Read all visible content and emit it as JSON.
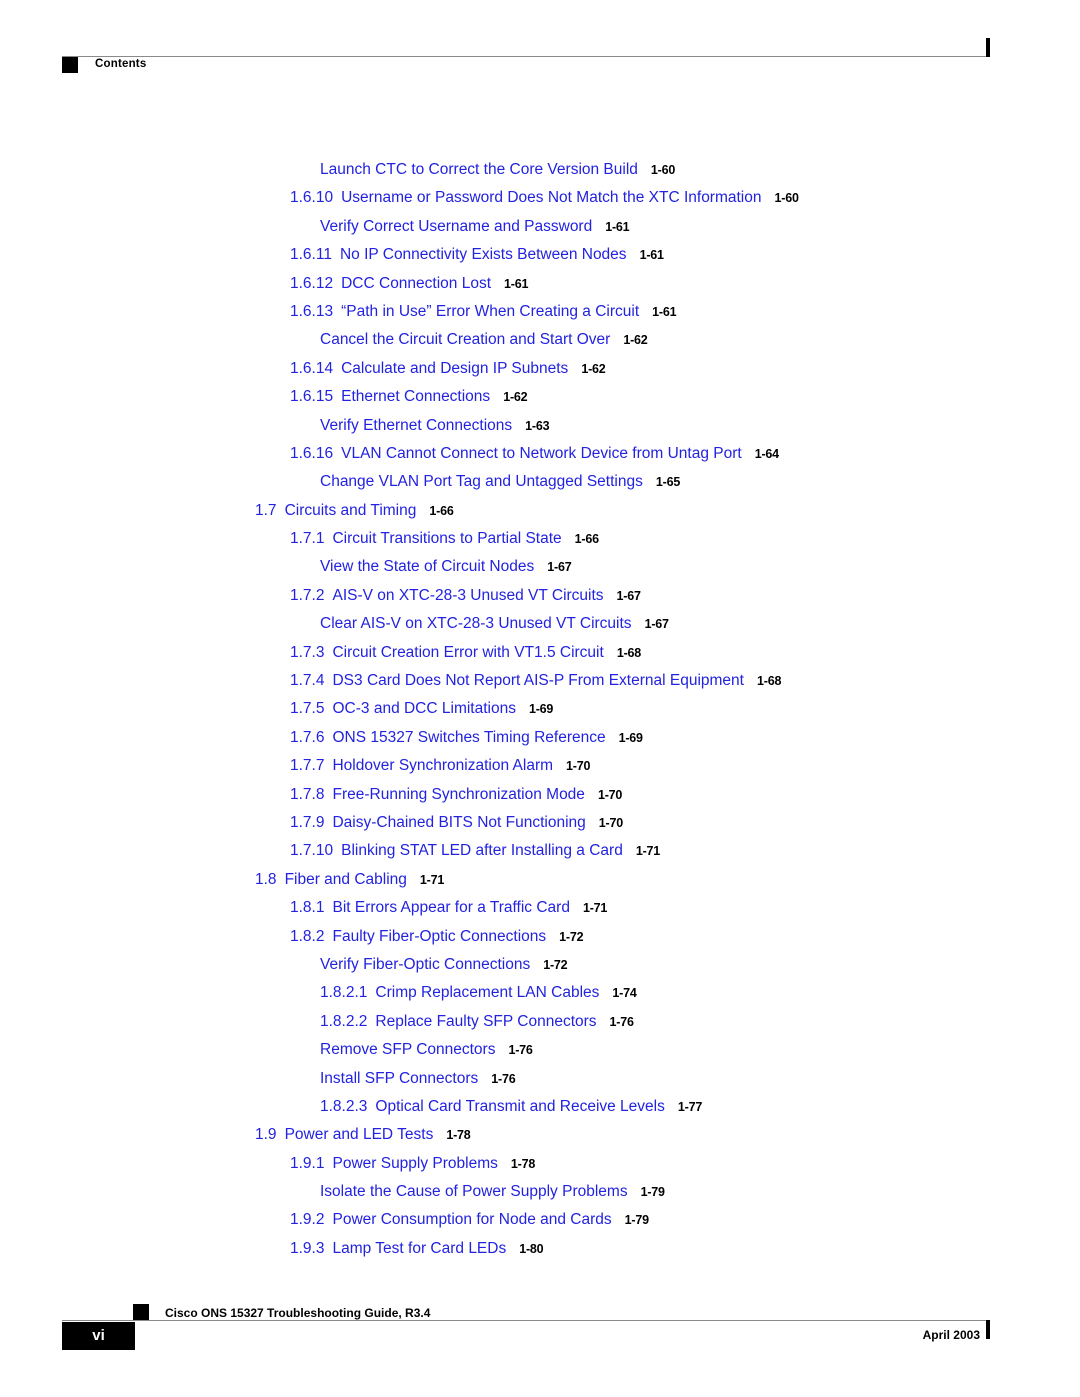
{
  "header": {
    "label": "Contents",
    "marker_icon": "black-square-marker",
    "rule_color": "#8a8a8a"
  },
  "theme": {
    "link_color": "#2222e0",
    "page_number_color": "#000000",
    "background": "#ffffff"
  },
  "toc": {
    "entries": [
      {
        "level": 3,
        "number": "",
        "title": "Launch CTC to Correct the Core Version Build",
        "page": "1-60"
      },
      {
        "level": 2,
        "number": "1.6.10",
        "title": "Username or Password Does Not Match the XTC Information",
        "page": "1-60"
      },
      {
        "level": 3,
        "number": "",
        "title": "Verify Correct Username and Password",
        "page": "1-61"
      },
      {
        "level": 2,
        "number": "1.6.11",
        "title": "No IP Connectivity Exists Between Nodes",
        "page": "1-61"
      },
      {
        "level": 2,
        "number": "1.6.12",
        "title": "DCC Connection Lost",
        "page": "1-61"
      },
      {
        "level": 2,
        "number": "1.6.13",
        "title": "“Path in Use” Error When Creating a Circuit",
        "page": "1-61"
      },
      {
        "level": 3,
        "number": "",
        "title": "Cancel the Circuit Creation and Start Over",
        "page": "1-62"
      },
      {
        "level": 2,
        "number": "1.6.14",
        "title": "Calculate and Design IP Subnets",
        "page": "1-62"
      },
      {
        "level": 2,
        "number": "1.6.15",
        "title": "Ethernet Connections",
        "page": "1-62"
      },
      {
        "level": 3,
        "number": "",
        "title": "Verify Ethernet Connections",
        "page": "1-63"
      },
      {
        "level": 2,
        "number": "1.6.16",
        "title": "VLAN Cannot Connect to Network Device from Untag Port",
        "page": "1-64"
      },
      {
        "level": 3,
        "number": "",
        "title": "Change VLAN Port Tag and Untagged Settings",
        "page": "1-65"
      },
      {
        "level": 1,
        "number": "1.7",
        "title": "Circuits and Timing",
        "page": "1-66"
      },
      {
        "level": 2,
        "number": "1.7.1",
        "title": "Circuit Transitions to Partial State",
        "page": "1-66"
      },
      {
        "level": 3,
        "number": "",
        "title": "View the State of Circuit Nodes",
        "page": "1-67"
      },
      {
        "level": 2,
        "number": "1.7.2",
        "title": "AIS-V on XTC-28-3 Unused VT Circuits",
        "page": "1-67"
      },
      {
        "level": 3,
        "number": "",
        "title": "Clear AIS-V on XTC-28-3 Unused VT Circuits",
        "page": "1-67"
      },
      {
        "level": 2,
        "number": "1.7.3",
        "title": "Circuit Creation Error with VT1.5 Circuit",
        "page": "1-68"
      },
      {
        "level": 2,
        "number": "1.7.4",
        "title": "DS3 Card Does Not Report AIS-P From External Equipment",
        "page": "1-68"
      },
      {
        "level": 2,
        "number": "1.7.5",
        "title": "OC-3 and DCC Limitations",
        "page": "1-69"
      },
      {
        "level": 2,
        "number": "1.7.6",
        "title": "ONS 15327 Switches Timing Reference",
        "page": "1-69"
      },
      {
        "level": 2,
        "number": "1.7.7",
        "title": "Holdover Synchronization Alarm",
        "page": "1-70"
      },
      {
        "level": 2,
        "number": "1.7.8",
        "title": "Free-Running Synchronization Mode",
        "page": "1-70"
      },
      {
        "level": 2,
        "number": "1.7.9",
        "title": "Daisy-Chained BITS Not Functioning",
        "page": "1-70"
      },
      {
        "level": 2,
        "number": "1.7.10",
        "title": "Blinking STAT LED after Installing a Card",
        "page": "1-71"
      },
      {
        "level": 1,
        "number": "1.8",
        "title": "Fiber and Cabling",
        "page": "1-71"
      },
      {
        "level": 2,
        "number": "1.8.1",
        "title": "Bit Errors Appear for a Traffic Card",
        "page": "1-71"
      },
      {
        "level": 2,
        "number": "1.8.2",
        "title": "Faulty Fiber-Optic Connections",
        "page": "1-72"
      },
      {
        "level": 3,
        "number": "",
        "title": "Verify Fiber-Optic Connections",
        "page": "1-72"
      },
      {
        "level": 4,
        "number": "1.8.2.1",
        "title": "Crimp Replacement LAN Cables",
        "page": "1-74"
      },
      {
        "level": 4,
        "number": "1.8.2.2",
        "title": "Replace Faulty SFP Connectors",
        "page": "1-76"
      },
      {
        "level": 3,
        "number": "",
        "title": "Remove SFP Connectors",
        "page": "1-76"
      },
      {
        "level": 3,
        "number": "",
        "title": "Install SFP Connectors",
        "page": "1-76"
      },
      {
        "level": 4,
        "number": "1.8.2.3",
        "title": "Optical Card Transmit and Receive Levels",
        "page": "1-77"
      },
      {
        "level": 1,
        "number": "1.9",
        "title": "Power and LED Tests",
        "page": "1-78"
      },
      {
        "level": 2,
        "number": "1.9.1",
        "title": "Power Supply Problems",
        "page": "1-78"
      },
      {
        "level": 3,
        "number": "",
        "title": "Isolate the Cause of Power Supply Problems",
        "page": "1-79"
      },
      {
        "level": 2,
        "number": "1.9.2",
        "title": "Power Consumption for Node and Cards",
        "page": "1-79"
      },
      {
        "level": 2,
        "number": "1.9.3",
        "title": "Lamp Test for Card LEDs",
        "page": "1-80"
      }
    ]
  },
  "footer": {
    "page_number": "vi",
    "document_title": "Cisco ONS 15327 Troubleshooting Guide, R3.4",
    "date": "April 2003",
    "marker_icon": "black-square-marker"
  }
}
